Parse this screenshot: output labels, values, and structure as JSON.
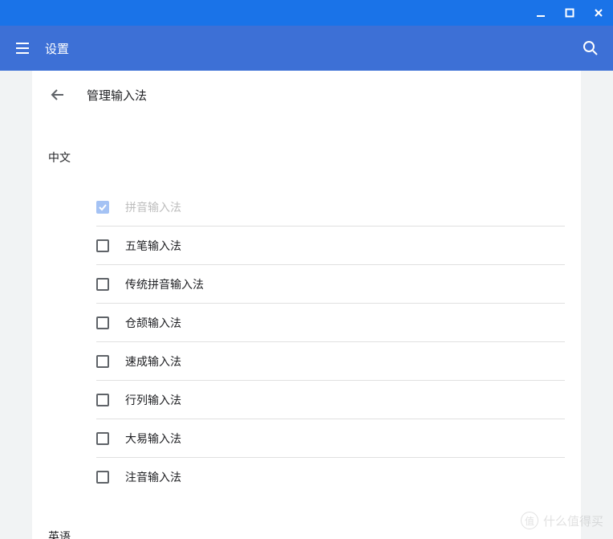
{
  "appbar": {
    "title": "设置"
  },
  "page": {
    "title": "管理输入法"
  },
  "sections": {
    "chinese": {
      "label": "中文",
      "items": [
        {
          "label": "拼音输入法",
          "checked": true,
          "disabled": true
        },
        {
          "label": "五笔输入法",
          "checked": false,
          "disabled": false
        },
        {
          "label": "传统拼音输入法",
          "checked": false,
          "disabled": false
        },
        {
          "label": "仓颉输入法",
          "checked": false,
          "disabled": false
        },
        {
          "label": "速成输入法",
          "checked": false,
          "disabled": false
        },
        {
          "label": "行列输入法",
          "checked": false,
          "disabled": false
        },
        {
          "label": "大易输入法",
          "checked": false,
          "disabled": false
        },
        {
          "label": "注音输入法",
          "checked": false,
          "disabled": false
        }
      ]
    },
    "english": {
      "label": "英语"
    }
  },
  "watermark": {
    "badge": "值",
    "text": "什么值得买"
  }
}
